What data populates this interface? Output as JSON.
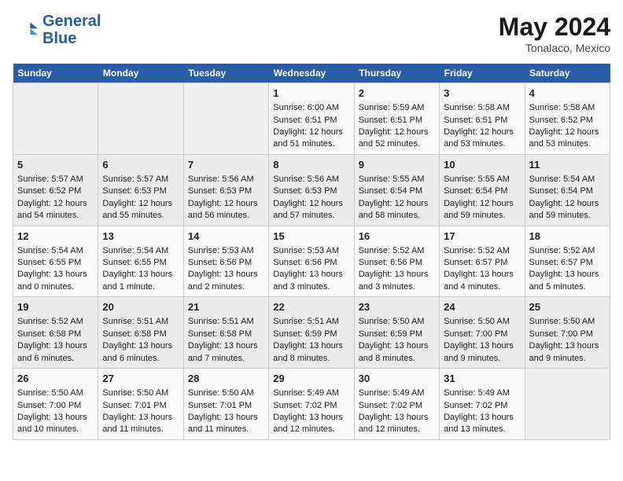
{
  "header": {
    "logo_line1": "General",
    "logo_line2": "Blue",
    "month_year": "May 2024",
    "location": "Tonalaco, Mexico"
  },
  "days_of_week": [
    "Sunday",
    "Monday",
    "Tuesday",
    "Wednesday",
    "Thursday",
    "Friday",
    "Saturday"
  ],
  "weeks": [
    [
      {
        "day": "",
        "info": ""
      },
      {
        "day": "",
        "info": ""
      },
      {
        "day": "",
        "info": ""
      },
      {
        "day": "1",
        "info": "Sunrise: 6:00 AM\nSunset: 6:51 PM\nDaylight: 12 hours\nand 51 minutes."
      },
      {
        "day": "2",
        "info": "Sunrise: 5:59 AM\nSunset: 6:51 PM\nDaylight: 12 hours\nand 52 minutes."
      },
      {
        "day": "3",
        "info": "Sunrise: 5:58 AM\nSunset: 6:51 PM\nDaylight: 12 hours\nand 53 minutes."
      },
      {
        "day": "4",
        "info": "Sunrise: 5:58 AM\nSunset: 6:52 PM\nDaylight: 12 hours\nand 53 minutes."
      }
    ],
    [
      {
        "day": "5",
        "info": "Sunrise: 5:57 AM\nSunset: 6:52 PM\nDaylight: 12 hours\nand 54 minutes."
      },
      {
        "day": "6",
        "info": "Sunrise: 5:57 AM\nSunset: 6:53 PM\nDaylight: 12 hours\nand 55 minutes."
      },
      {
        "day": "7",
        "info": "Sunrise: 5:56 AM\nSunset: 6:53 PM\nDaylight: 12 hours\nand 56 minutes."
      },
      {
        "day": "8",
        "info": "Sunrise: 5:56 AM\nSunset: 6:53 PM\nDaylight: 12 hours\nand 57 minutes."
      },
      {
        "day": "9",
        "info": "Sunrise: 5:55 AM\nSunset: 6:54 PM\nDaylight: 12 hours\nand 58 minutes."
      },
      {
        "day": "10",
        "info": "Sunrise: 5:55 AM\nSunset: 6:54 PM\nDaylight: 12 hours\nand 59 minutes."
      },
      {
        "day": "11",
        "info": "Sunrise: 5:54 AM\nSunset: 6:54 PM\nDaylight: 12 hours\nand 59 minutes."
      }
    ],
    [
      {
        "day": "12",
        "info": "Sunrise: 5:54 AM\nSunset: 6:55 PM\nDaylight: 13 hours\nand 0 minutes."
      },
      {
        "day": "13",
        "info": "Sunrise: 5:54 AM\nSunset: 6:55 PM\nDaylight: 13 hours\nand 1 minute."
      },
      {
        "day": "14",
        "info": "Sunrise: 5:53 AM\nSunset: 6:56 PM\nDaylight: 13 hours\nand 2 minutes."
      },
      {
        "day": "15",
        "info": "Sunrise: 5:53 AM\nSunset: 6:56 PM\nDaylight: 13 hours\nand 3 minutes."
      },
      {
        "day": "16",
        "info": "Sunrise: 5:52 AM\nSunset: 6:56 PM\nDaylight: 13 hours\nand 3 minutes."
      },
      {
        "day": "17",
        "info": "Sunrise: 5:52 AM\nSunset: 6:57 PM\nDaylight: 13 hours\nand 4 minutes."
      },
      {
        "day": "18",
        "info": "Sunrise: 5:52 AM\nSunset: 6:57 PM\nDaylight: 13 hours\nand 5 minutes."
      }
    ],
    [
      {
        "day": "19",
        "info": "Sunrise: 5:52 AM\nSunset: 6:58 PM\nDaylight: 13 hours\nand 6 minutes."
      },
      {
        "day": "20",
        "info": "Sunrise: 5:51 AM\nSunset: 6:58 PM\nDaylight: 13 hours\nand 6 minutes."
      },
      {
        "day": "21",
        "info": "Sunrise: 5:51 AM\nSunset: 6:58 PM\nDaylight: 13 hours\nand 7 minutes."
      },
      {
        "day": "22",
        "info": "Sunrise: 5:51 AM\nSunset: 6:59 PM\nDaylight: 13 hours\nand 8 minutes."
      },
      {
        "day": "23",
        "info": "Sunrise: 5:50 AM\nSunset: 6:59 PM\nDaylight: 13 hours\nand 8 minutes."
      },
      {
        "day": "24",
        "info": "Sunrise: 5:50 AM\nSunset: 7:00 PM\nDaylight: 13 hours\nand 9 minutes."
      },
      {
        "day": "25",
        "info": "Sunrise: 5:50 AM\nSunset: 7:00 PM\nDaylight: 13 hours\nand 9 minutes."
      }
    ],
    [
      {
        "day": "26",
        "info": "Sunrise: 5:50 AM\nSunset: 7:00 PM\nDaylight: 13 hours\nand 10 minutes."
      },
      {
        "day": "27",
        "info": "Sunrise: 5:50 AM\nSunset: 7:01 PM\nDaylight: 13 hours\nand 11 minutes."
      },
      {
        "day": "28",
        "info": "Sunrise: 5:50 AM\nSunset: 7:01 PM\nDaylight: 13 hours\nand 11 minutes."
      },
      {
        "day": "29",
        "info": "Sunrise: 5:49 AM\nSunset: 7:02 PM\nDaylight: 13 hours\nand 12 minutes."
      },
      {
        "day": "30",
        "info": "Sunrise: 5:49 AM\nSunset: 7:02 PM\nDaylight: 13 hours\nand 12 minutes."
      },
      {
        "day": "31",
        "info": "Sunrise: 5:49 AM\nSunset: 7:02 PM\nDaylight: 13 hours\nand 13 minutes."
      },
      {
        "day": "",
        "info": ""
      }
    ]
  ]
}
